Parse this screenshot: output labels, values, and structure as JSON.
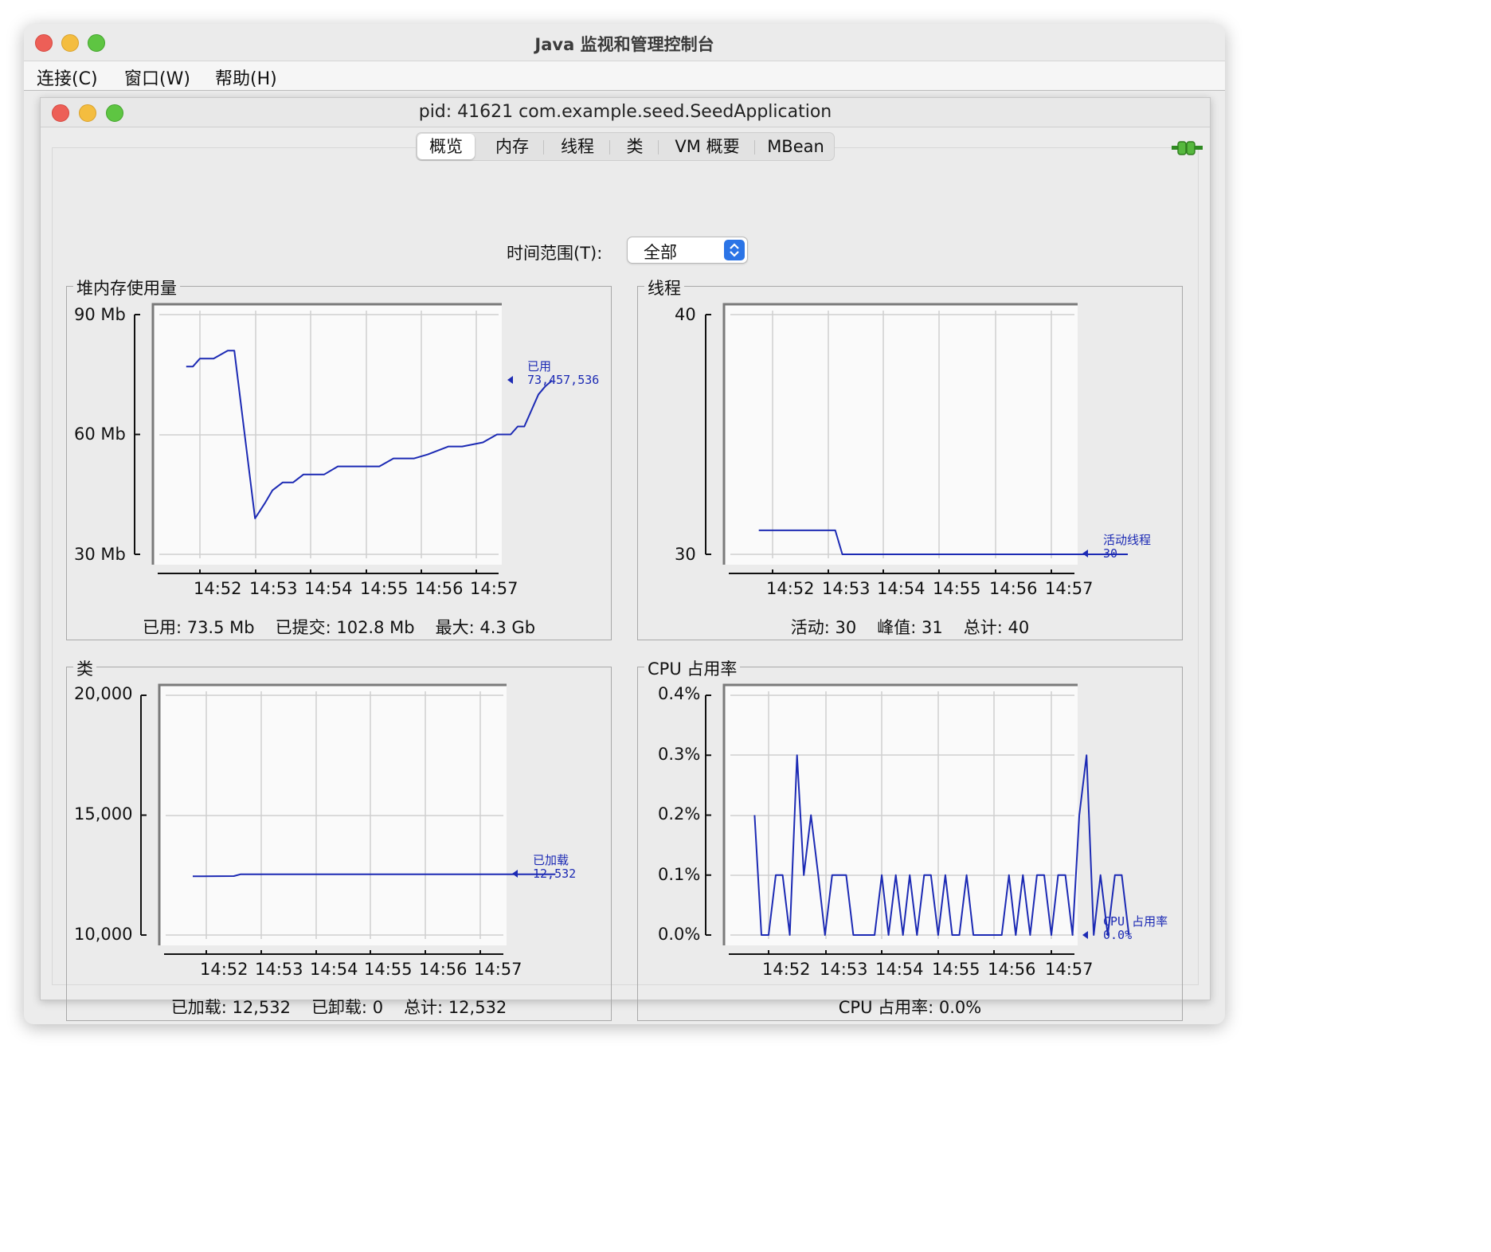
{
  "window": {
    "title": "Java 监视和管理控制台",
    "menu": [
      "连接(C)",
      "窗口(W)",
      "帮助(H)"
    ]
  },
  "process_window": {
    "title": "pid: 41621 com.example.seed.SeedApplication",
    "tabs": [
      "概览",
      "内存",
      "线程",
      "类",
      "VM 概要",
      "MBean"
    ],
    "active_tab": "概览",
    "connection_icon": "connected-plug-icon"
  },
  "time_range": {
    "label": "时间范围(T):",
    "value": "全部"
  },
  "colors": {
    "series": "#1c2ab4",
    "grid": "#cfcfcf",
    "plot_bg": "#fafafa",
    "accent": "#2b74e6"
  },
  "panels": {
    "heap": {
      "title": "堆内存使用量",
      "y_ticks": [
        "90 Mb",
        "60 Mb",
        "30 Mb"
      ],
      "x_ticks": [
        "14:52",
        "14:53",
        "14:54",
        "14:55",
        "14:56",
        "14:57"
      ],
      "legend_name": "已用",
      "legend_value": "73,457,536",
      "stats": [
        "已用: 73.5 Mb",
        "已提交: 102.8 Mb",
        "最大: 4.3 Gb"
      ]
    },
    "threads": {
      "title": "线程",
      "y_ticks": [
        "40",
        "30"
      ],
      "x_ticks": [
        "14:52",
        "14:53",
        "14:54",
        "14:55",
        "14:56",
        "14:57"
      ],
      "legend_name": "活动线程",
      "legend_value": "30",
      "stats": [
        "活动: 30",
        "峰值: 31",
        "总计: 40"
      ]
    },
    "classes": {
      "title": "类",
      "y_ticks": [
        "20,000",
        "15,000",
        "10,000"
      ],
      "x_ticks": [
        "14:52",
        "14:53",
        "14:54",
        "14:55",
        "14:56",
        "14:57"
      ],
      "legend_name": "已加载",
      "legend_value": "12,532",
      "stats": [
        "已加载: 12,532",
        "已卸载: 0",
        "总计: 12,532"
      ]
    },
    "cpu": {
      "title": "CPU 占用率",
      "y_ticks": [
        "0.4%",
        "0.3%",
        "0.2%",
        "0.1%",
        "0.0%"
      ],
      "x_ticks": [
        "14:52",
        "14:53",
        "14:54",
        "14:55",
        "14:56",
        "14:57"
      ],
      "legend_name": "CPU 占用率",
      "legend_value": "0.0%",
      "stats": [
        "CPU 占用率: 0.0%"
      ]
    }
  },
  "chart_data": [
    {
      "type": "line",
      "title": "堆内存使用量",
      "ylabel": "Mb",
      "ylim": [
        30,
        90
      ],
      "x_ticks": [
        "14:52",
        "14:53",
        "14:54",
        "14:55",
        "14:56",
        "14:57"
      ],
      "series": [
        {
          "name": "已用",
          "x": [
            14.5167,
            14.5183,
            14.52,
            14.5233,
            14.5267,
            14.5283,
            14.5333,
            14.5358,
            14.5375,
            14.54,
            14.5425,
            14.545,
            14.5483,
            14.55,
            14.5533,
            14.555,
            14.5583,
            14.5633,
            14.5667,
            14.5717,
            14.575,
            14.58,
            14.5833,
            14.5883,
            14.5917,
            14.595,
            14.5967,
            14.5983,
            14.6017,
            14.6033,
            14.605
          ],
          "y": [
            77,
            77,
            79,
            79,
            81,
            81,
            39,
            43,
            46,
            48,
            48,
            50,
            50,
            50,
            52,
            52,
            52,
            52,
            54,
            54,
            55,
            57,
            57,
            58,
            60,
            60,
            62,
            62,
            70,
            72,
            73.5
          ]
        }
      ]
    },
    {
      "type": "line",
      "title": "线程",
      "ylim": [
        30,
        40
      ],
      "x_ticks": [
        "14:52",
        "14:53",
        "14:54",
        "14:55",
        "14:56",
        "14:57"
      ],
      "series": [
        {
          "name": "活动线程",
          "x": [
            14.5167,
            14.535,
            14.5367,
            14.605
          ],
          "y": [
            31,
            31,
            30,
            30
          ]
        }
      ]
    },
    {
      "type": "line",
      "title": "类",
      "ylim": [
        10000,
        20000
      ],
      "x_ticks": [
        "14:52",
        "14:53",
        "14:54",
        "14:55",
        "14:56",
        "14:57"
      ],
      "series": [
        {
          "name": "已加载",
          "x": [
            14.5167,
            14.5267,
            14.5283,
            14.605
          ],
          "y": [
            12450,
            12460,
            12532,
            12532
          ]
        }
      ]
    },
    {
      "type": "line",
      "title": "CPU 占用率",
      "ylabel": "%",
      "ylim": [
        0.0,
        0.4
      ],
      "x_ticks": [
        "14:52",
        "14:53",
        "14:54",
        "14:55",
        "14:56",
        "14:57"
      ],
      "series": [
        {
          "name": "CPU 占用率",
          "x": [
            14.5167,
            14.5183,
            14.52,
            14.5217,
            14.5233,
            14.525,
            14.5267,
            14.5283,
            14.53,
            14.5317,
            14.5333,
            14.535,
            14.5367,
            14.5383,
            14.54,
            14.5417,
            14.5433,
            14.545,
            14.5467,
            14.5483,
            14.55,
            14.5517,
            14.5533,
            14.555,
            14.5567,
            14.5583,
            14.56,
            14.5617,
            14.5633,
            14.565,
            14.5667,
            14.5683,
            14.57,
            14.5717,
            14.5733,
            14.575,
            14.5767,
            14.5783,
            14.58,
            14.5817,
            14.5833,
            14.585,
            14.5867,
            14.5883,
            14.59,
            14.5917,
            14.5933,
            14.595,
            14.5967,
            14.5983,
            14.6,
            14.6017,
            14.6033,
            14.605
          ],
          "y": [
            0.2,
            0.0,
            0.0,
            0.1,
            0.1,
            0.0,
            0.3,
            0.1,
            0.2,
            0.1,
            0.0,
            0.1,
            0.1,
            0.1,
            0.0,
            0.0,
            0.0,
            0.0,
            0.1,
            0.0,
            0.1,
            0.0,
            0.1,
            0.0,
            0.1,
            0.1,
            0.0,
            0.1,
            0.0,
            0.0,
            0.1,
            0.0,
            0.0,
            0.0,
            0.0,
            0.0,
            0.1,
            0.0,
            0.1,
            0.0,
            0.1,
            0.1,
            0.0,
            0.1,
            0.1,
            0.0,
            0.2,
            0.3,
            0.0,
            0.1,
            0.0,
            0.1,
            0.1,
            0.0
          ]
        }
      ]
    }
  ]
}
